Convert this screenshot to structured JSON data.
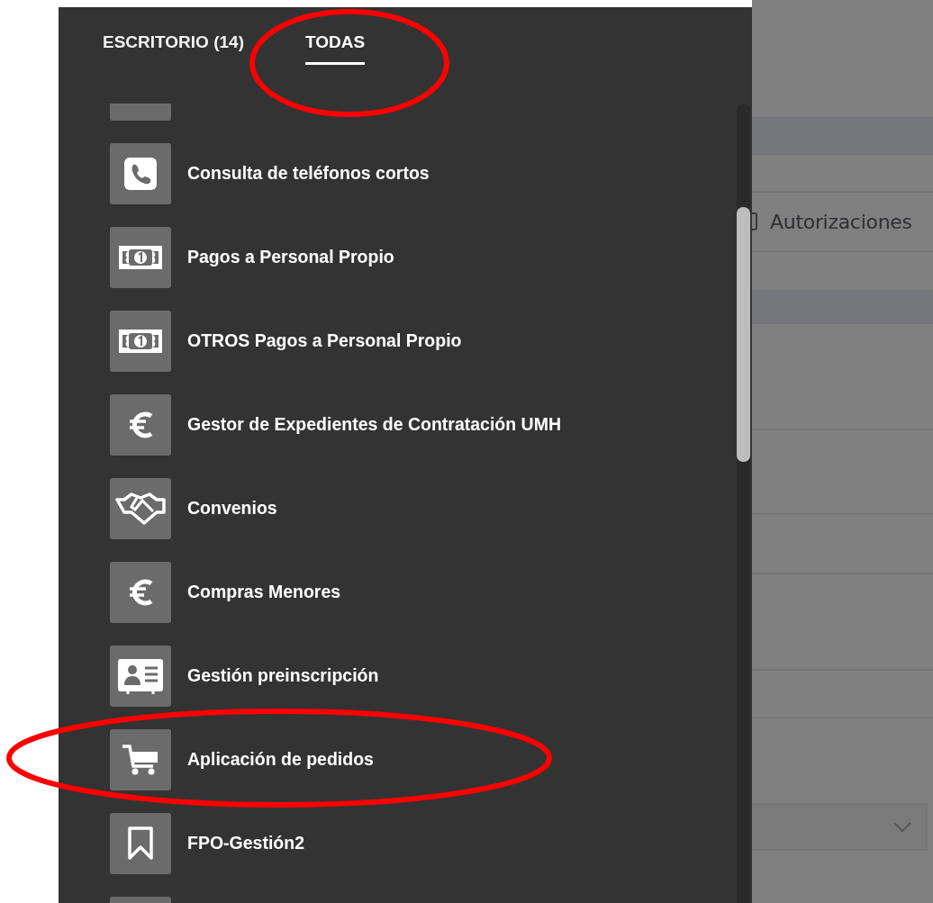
{
  "tabs": [
    {
      "label": "ESCRITORIO (14)",
      "selected": false
    },
    {
      "label": "TODAS",
      "selected": true
    }
  ],
  "apps": [
    {
      "kind": "blank"
    },
    {
      "label": "Consulta de teléfonos cortos",
      "kind": "phone"
    },
    {
      "label": "Pagos a Personal Propio",
      "kind": "banknote"
    },
    {
      "label": "OTROS Pagos a Personal Propio",
      "kind": "banknote"
    },
    {
      "label": "Gestor de Expedientes de Contratación UMH",
      "kind": "euro"
    },
    {
      "label": "Convenios",
      "kind": "handshake"
    },
    {
      "label": "Compras Menores",
      "kind": "euro"
    },
    {
      "label": "Gestión preinscripción",
      "kind": "card"
    },
    {
      "label": "Aplicación de pedidos",
      "kind": "cart"
    },
    {
      "label": "FPO-Gestión2",
      "kind": "bookmark"
    },
    {
      "kind": "blank"
    }
  ],
  "options": [
    {
      "label": "Autorizaciones",
      "checked": false
    }
  ],
  "annotations": [
    {
      "kind": "ellipse"
    },
    {
      "kind": "ellipse"
    }
  ]
}
